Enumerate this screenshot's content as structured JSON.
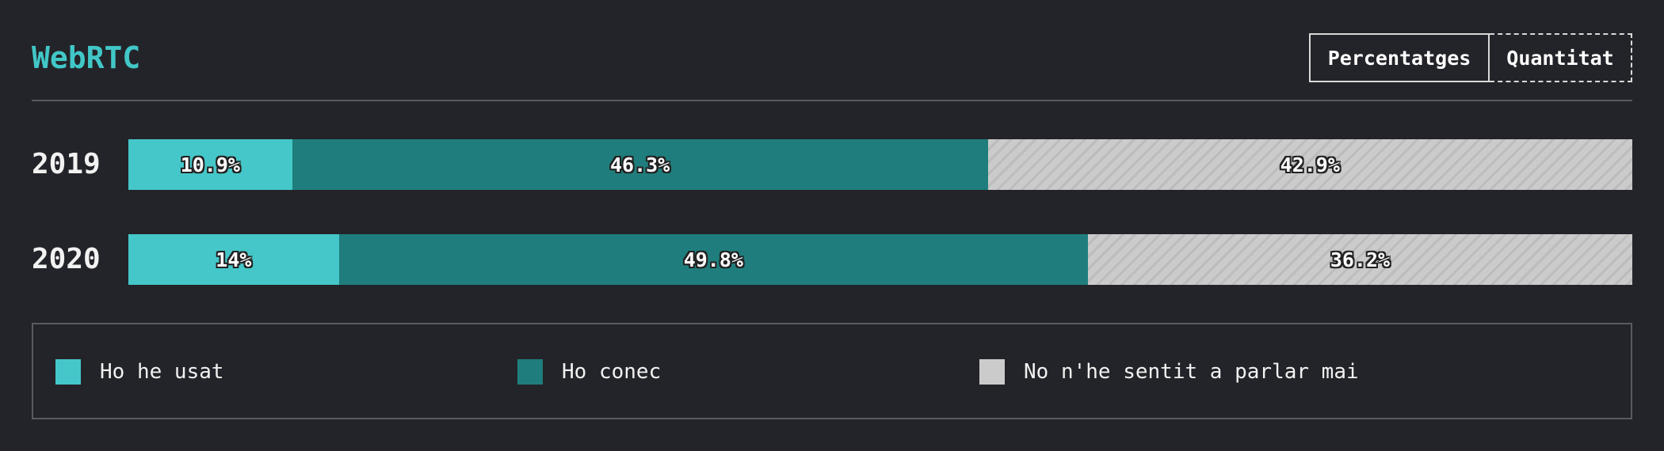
{
  "title": "WebRTC",
  "toggle": {
    "percent_label": "Percentatges",
    "count_label": "Quantitat",
    "selected": "Percentatges"
  },
  "legend": [
    {
      "label": "Ho he usat",
      "color": "#45c7c9"
    },
    {
      "label": "Ho conec",
      "color": "#1f7e7d"
    },
    {
      "label": "No n'he sentit a parlar mai",
      "color": "#cbcbcb"
    }
  ],
  "chart_data": {
    "type": "bar",
    "orientation": "horizontal",
    "stacked": true,
    "normalized": true,
    "title": "WebRTC",
    "categories": [
      "2019",
      "2020"
    ],
    "series": [
      {
        "name": "Ho he usat",
        "values": [
          10.9,
          14
        ],
        "labels": [
          "10.9%",
          "14%"
        ],
        "color": "#45c7c9"
      },
      {
        "name": "Ho conec",
        "values": [
          46.3,
          49.8
        ],
        "labels": [
          "46.3%",
          "49.8%"
        ],
        "color": "#1f7e7d"
      },
      {
        "name": "No n'he sentit a parlar mai",
        "values": [
          42.9,
          36.2
        ],
        "labels": [
          "42.9%",
          "36.2%"
        ],
        "color": "#cbcbcb"
      }
    ],
    "legend_position": "bottom"
  }
}
